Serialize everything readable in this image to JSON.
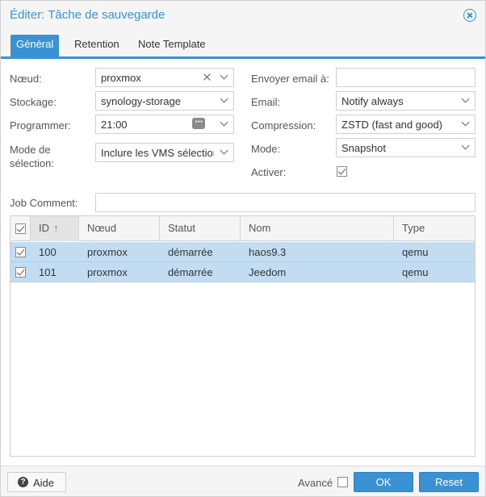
{
  "window": {
    "title": "Éditer: Tâche de sauvegarde"
  },
  "tabs": [
    "Général",
    "Retention",
    "Note Template"
  ],
  "form": {
    "node": {
      "label": "Nœud:",
      "value": "proxmox"
    },
    "storage": {
      "label": "Stockage:",
      "value": "synology-storage"
    },
    "schedule": {
      "label": "Programmer:",
      "value": "21:00"
    },
    "selection_mode": {
      "label": "Mode de sélection:",
      "value": "Inclure les VMS sélectionnées"
    },
    "email_to": {
      "label": "Envoyer email à:",
      "value": ""
    },
    "email": {
      "label": "Email:",
      "value": "Notify always"
    },
    "compression": {
      "label": "Compression:",
      "value": "ZSTD (fast and good)"
    },
    "mode": {
      "label": "Mode:",
      "value": "Snapshot"
    },
    "enable": {
      "label": "Activer:",
      "checked": true
    },
    "job_comment": {
      "label": "Job Comment:",
      "value": ""
    }
  },
  "grid": {
    "columns": [
      "ID",
      "Nœud",
      "Statut",
      "Nom",
      "Type"
    ],
    "sort_arrow": "↑",
    "rows": [
      {
        "id": "100",
        "node": "proxmox",
        "status": "démarrée",
        "name": "haos9.3",
        "type": "qemu",
        "checked": true
      },
      {
        "id": "101",
        "node": "proxmox",
        "status": "démarrée",
        "name": "Jeedom",
        "type": "qemu",
        "checked": true
      }
    ]
  },
  "footer": {
    "help": "Aide",
    "advanced": "Avancé",
    "ok": "OK",
    "reset": "Reset"
  },
  "colors": {
    "accent": "#3892d4",
    "row_selected": "#c2ddf2"
  },
  "icons": {
    "close": "close-circle-icon",
    "help": "help-circle-icon",
    "dropdown": "chevron-down-icon",
    "clear": "clear-x-icon",
    "schedule": "more-dots-icon"
  }
}
